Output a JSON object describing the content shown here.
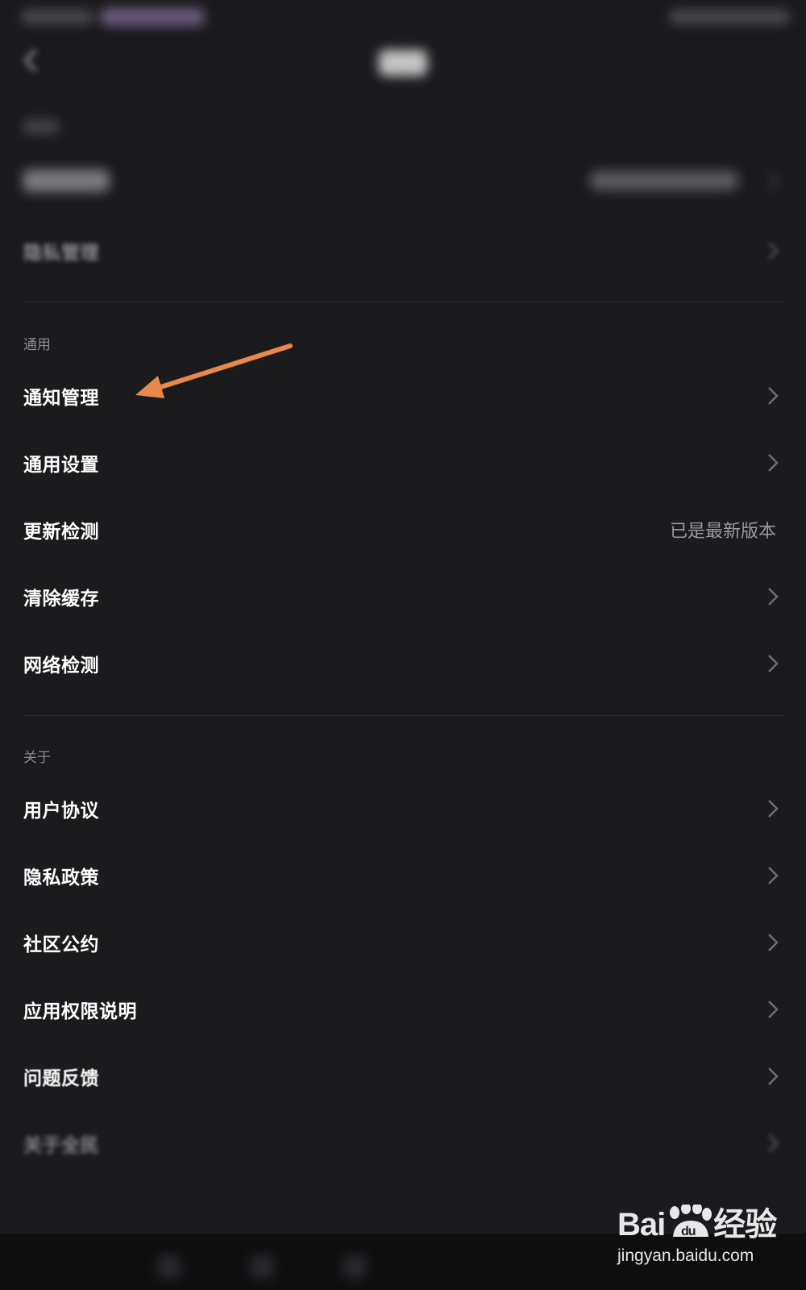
{
  "colors": {
    "background": "#1b1b1d",
    "text_primary": "#ffffff",
    "text_secondary": "#8a8a8e",
    "value_text": "#9a9a9e",
    "chevron": "#6e6e72",
    "divider": "#2f2f33",
    "annotation_arrow": "#e8884a"
  },
  "top_section": {
    "privacy_management_label": "隐私管理"
  },
  "general_section": {
    "header": "通用",
    "items": [
      {
        "label": "通知管理",
        "icon": "chevron-right-icon"
      },
      {
        "label": "通用设置",
        "icon": "chevron-right-icon"
      },
      {
        "label": "更新检测",
        "value": "已是最新版本"
      },
      {
        "label": "清除缓存",
        "icon": "chevron-right-icon"
      },
      {
        "label": "网络检测",
        "icon": "chevron-right-icon"
      }
    ]
  },
  "about_section": {
    "header": "关于",
    "items": [
      {
        "label": "用户协议",
        "icon": "chevron-right-icon"
      },
      {
        "label": "隐私政策",
        "icon": "chevron-right-icon"
      },
      {
        "label": "社区公约",
        "icon": "chevron-right-icon"
      },
      {
        "label": "应用权限说明",
        "icon": "chevron-right-icon"
      },
      {
        "label": "问题反馈",
        "icon": "chevron-right-icon"
      },
      {
        "label": "关于全民",
        "icon": "chevron-right-icon"
      }
    ]
  },
  "watermark": {
    "logo_prefix": "Bai",
    "logo_suffix": "经验",
    "url": "jingyan.baidu.com"
  }
}
